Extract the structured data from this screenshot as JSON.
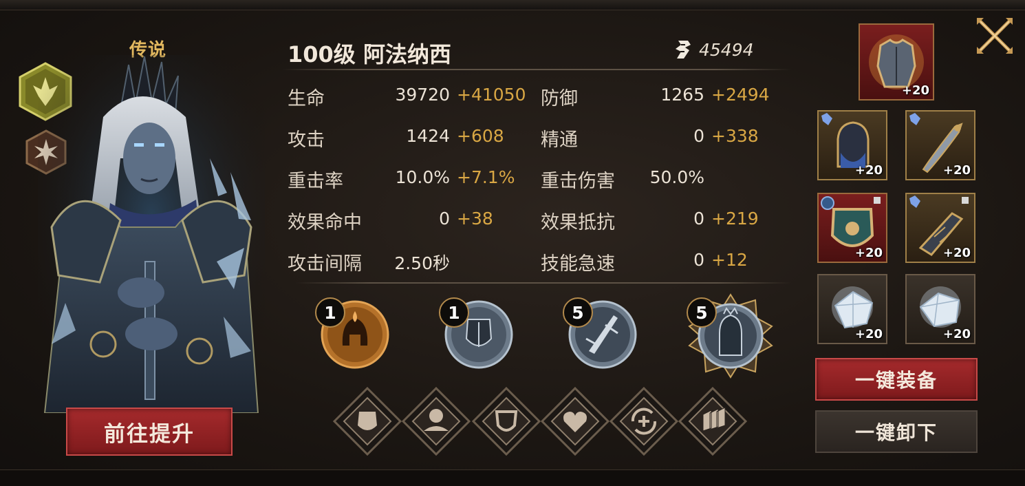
{
  "hero": {
    "rarity": "传说",
    "title": "100级  阿法纳西",
    "power": "45494",
    "go_upgrade_label": "前往提升"
  },
  "stats": [
    {
      "label": "生命",
      "value": "39720",
      "bonus": "+41050"
    },
    {
      "label": "防御",
      "value": "1265",
      "bonus": "+2494"
    },
    {
      "label": "攻击",
      "value": "1424",
      "bonus": "+608"
    },
    {
      "label": "精通",
      "value": "0",
      "bonus": "+338"
    },
    {
      "label": "重击率",
      "value": "10.0%",
      "bonus": "+7.1%"
    },
    {
      "label": "重击伤害",
      "value": "50.0%",
      "bonus": ""
    },
    {
      "label": "效果命中",
      "value": "0",
      "bonus": "+38"
    },
    {
      "label": "效果抵抗",
      "value": "0",
      "bonus": "+219"
    },
    {
      "label": "攻击间隔",
      "value": "2.50秒",
      "bonus": ""
    },
    {
      "label": "技能急速",
      "value": "0",
      "bonus": "+12"
    }
  ],
  "skills": [
    {
      "level": "1",
      "icon": "spartan-helmet-flame-icon"
    },
    {
      "level": "1",
      "icon": "shield-knight-icon"
    },
    {
      "level": "5",
      "icon": "sword-slash-icon"
    },
    {
      "level": "5",
      "icon": "armored-warrior-icon"
    }
  ],
  "traits": [
    "helmet-shield-icon",
    "bust-icon",
    "shield-icon",
    "heart-icon",
    "heal-cycle-icon",
    "stack-armor-icon"
  ],
  "equipment": [
    {
      "name": "chest-armor",
      "enhance": "+20"
    },
    {
      "name": "helmet",
      "enhance": "+20"
    },
    {
      "name": "dagger",
      "enhance": "+20"
    },
    {
      "name": "shield",
      "enhance": "+20"
    },
    {
      "name": "gauntlet",
      "enhance": "+20"
    },
    {
      "name": "crystal-left",
      "enhance": "+20"
    },
    {
      "name": "crystal-right",
      "enhance": "+20"
    }
  ],
  "actions": {
    "equip_all": "一键装备",
    "unequip_all": "一键卸下"
  },
  "colors": {
    "accent_gold": "#d9a744",
    "rarity_gold": "#e2b85f",
    "button_red": "#a52a2c"
  }
}
